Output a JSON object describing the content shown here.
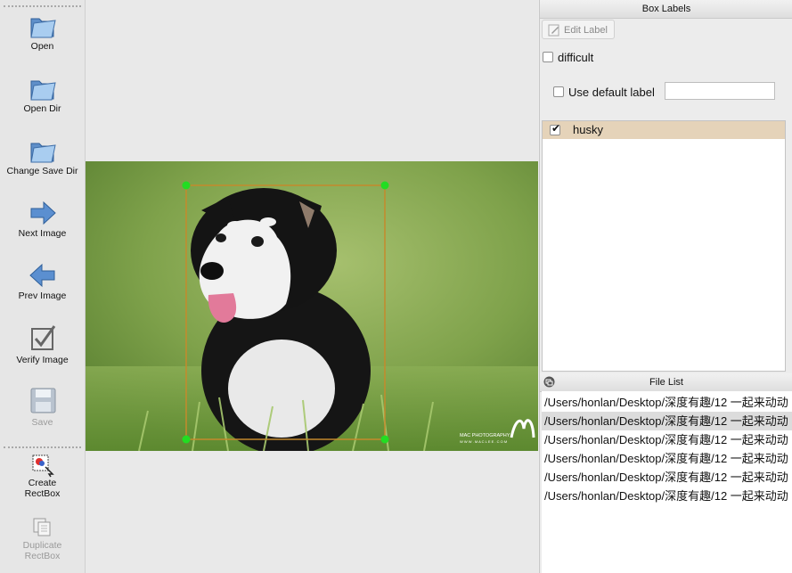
{
  "toolbar": {
    "items": [
      {
        "label": "Open",
        "icon": "folder-icon",
        "enabled": true
      },
      {
        "label": "Open Dir",
        "icon": "folder-icon",
        "enabled": true
      },
      {
        "label": "Change Save Dir",
        "icon": "folder-icon",
        "enabled": true
      },
      {
        "label": "Next Image",
        "icon": "arrow-right-icon",
        "enabled": true
      },
      {
        "label": "Prev Image",
        "icon": "arrow-left-icon",
        "enabled": true
      },
      {
        "label": "Verify Image",
        "icon": "checkbox-icon",
        "enabled": true
      },
      {
        "label": "Save",
        "icon": "floppy-icon",
        "enabled": false
      },
      {
        "label_line1": "Create",
        "label_line2": "RectBox",
        "icon": "rectbox-icon",
        "enabled": true
      },
      {
        "label_line1": "Duplicate",
        "label_line2": "RectBox",
        "icon": "duplicate-icon",
        "enabled": false
      }
    ]
  },
  "image": {
    "subject": "husky puppy",
    "watermark_line1": "MAC PHOTOGRAPHY",
    "watermark_line2": "W W W . M A C L E E . C O M",
    "bbox_color": "#c48a2c",
    "handle_color": "#22dd22"
  },
  "box_labels": {
    "title": "Box Labels",
    "edit_label_button": "Edit Label",
    "difficult_label": "difficult",
    "difficult_checked": false,
    "use_default_label": "Use default label",
    "use_default_checked": false,
    "default_label_value": "",
    "labels": [
      {
        "name": "husky",
        "checked": true,
        "selected_bg": "#e5d3b9"
      }
    ]
  },
  "file_list": {
    "title": "File List",
    "files": [
      {
        "path": "/Users/honlan/Desktop/深度有趣/12 一起来动动",
        "selected": false
      },
      {
        "path": "/Users/honlan/Desktop/深度有趣/12 一起来动动",
        "selected": true
      },
      {
        "path": "/Users/honlan/Desktop/深度有趣/12 一起来动动",
        "selected": false
      },
      {
        "path": "/Users/honlan/Desktop/深度有趣/12 一起来动动",
        "selected": false
      },
      {
        "path": "/Users/honlan/Desktop/深度有趣/12 一起来动动",
        "selected": false
      },
      {
        "path": "/Users/honlan/Desktop/深度有趣/12 一起来动动",
        "selected": false
      }
    ]
  }
}
